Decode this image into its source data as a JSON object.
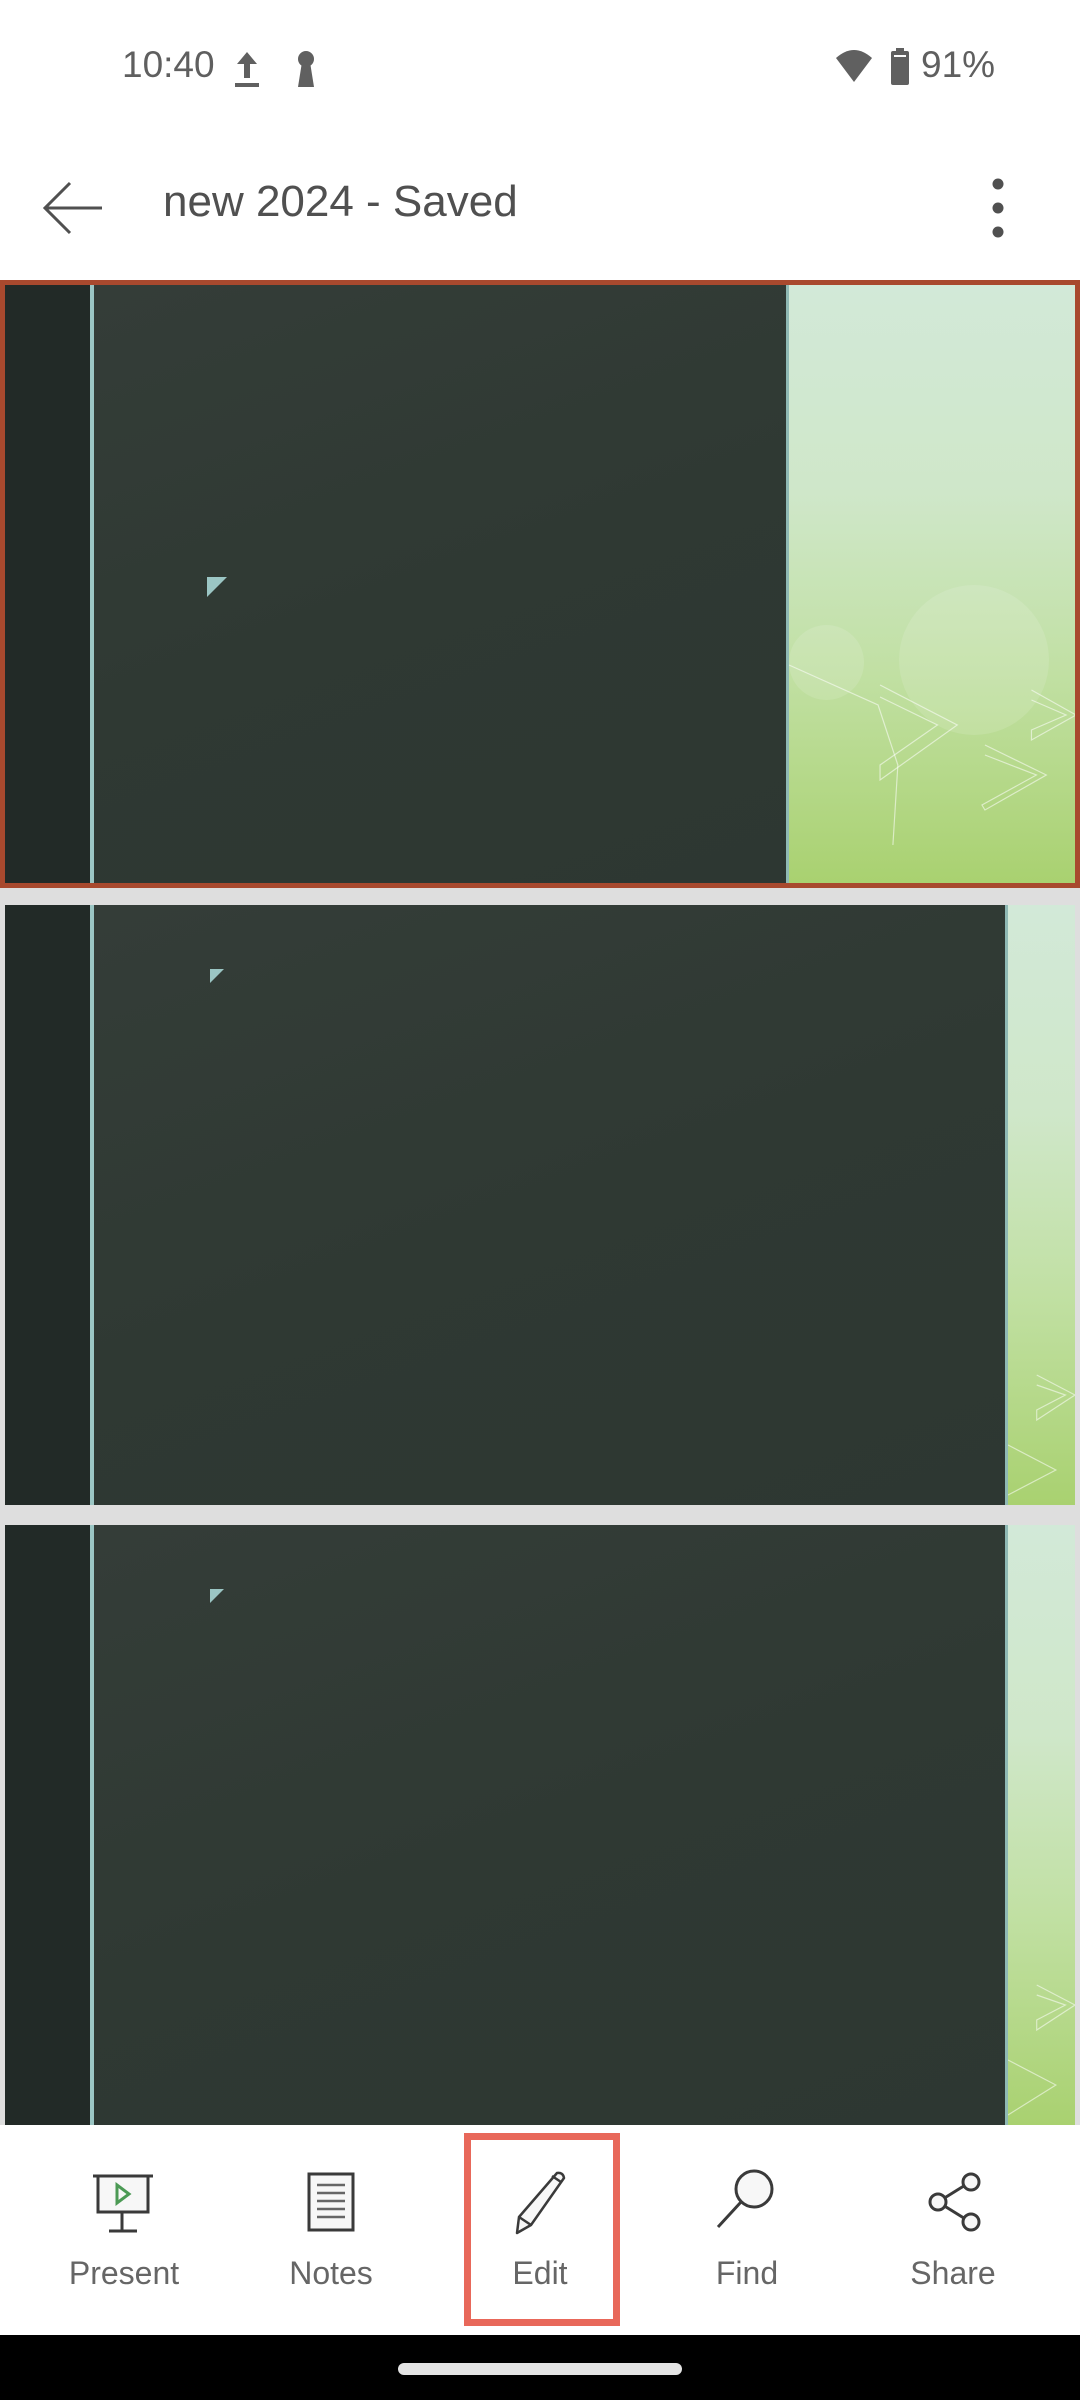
{
  "status_bar": {
    "time": "10:40",
    "icons_left": [
      "upload-icon",
      "keyhole-icon"
    ],
    "icons_right": [
      "wifi-icon",
      "battery-icon"
    ],
    "battery_percent": "91%"
  },
  "app_bar": {
    "back_icon": "arrow-left-icon",
    "title": "new 2024 - Saved",
    "more_icon": "more-vertical-icon"
  },
  "slides": [
    {
      "index": 1,
      "selected": true
    },
    {
      "index": 2,
      "selected": false
    },
    {
      "index": 3,
      "selected": false
    }
  ],
  "toolbar": {
    "items": [
      {
        "label": "Present",
        "icon": "presentation-play-icon"
      },
      {
        "label": "Notes",
        "icon": "notes-icon"
      },
      {
        "label": "Edit",
        "icon": "pencil-icon",
        "highlighted": true
      },
      {
        "label": "Find",
        "icon": "magnifier-icon"
      },
      {
        "label": "Share",
        "icon": "share-icon"
      }
    ]
  },
  "colors": {
    "selection_border": "#a8492e",
    "highlight_box": "#e8685a",
    "present_play": "#4c9a55",
    "slide_dark": "#2f3933",
    "slide_accent": "#9bc6c4"
  }
}
